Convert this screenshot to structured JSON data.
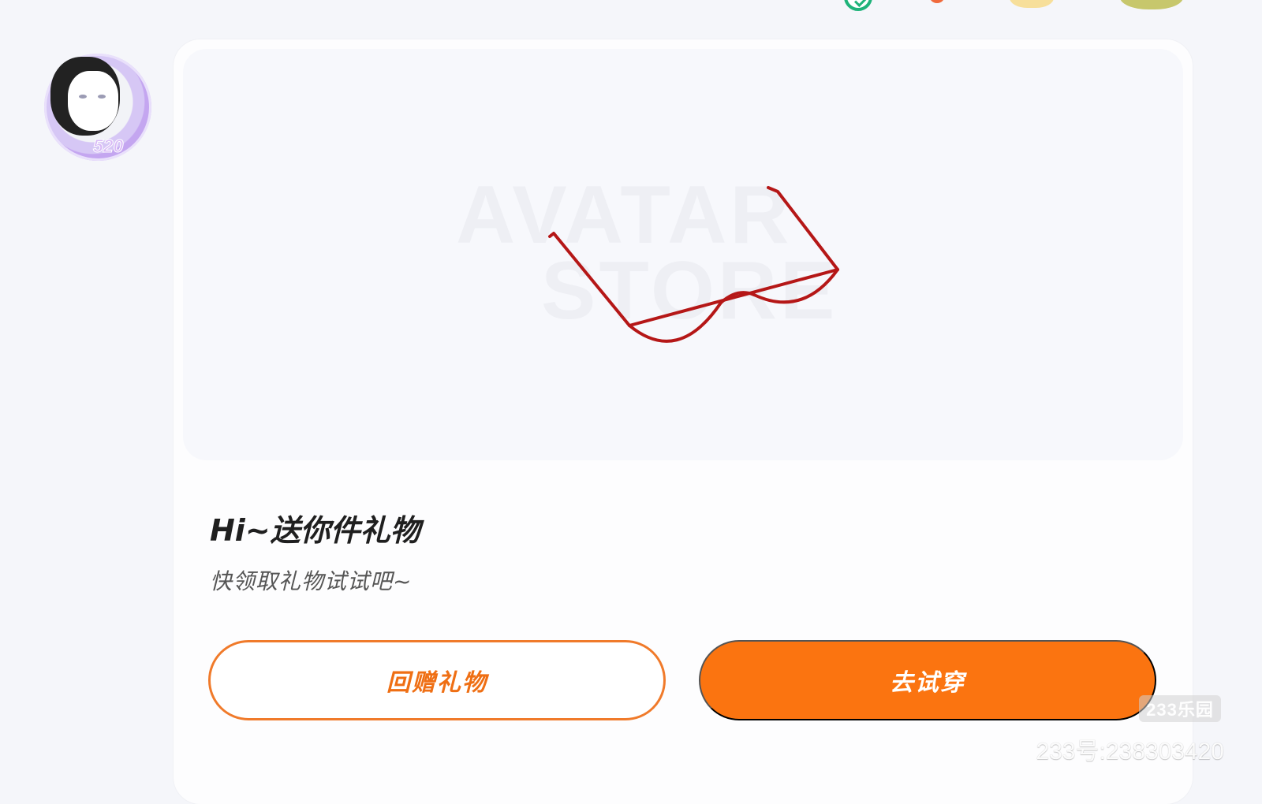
{
  "preview": {
    "watermark_line_1": "AVATAR",
    "watermark_line_2": "STORE"
  },
  "gift": {
    "title": "Hi~送你件礼物",
    "subtitle": "快领取礼物试试吧~",
    "return_gift_label": "回赠礼物",
    "try_on_label": "去试穿"
  },
  "avatar": {
    "badge_text": "520"
  },
  "watermark": {
    "brand": "233乐园",
    "account": "233号:238303420"
  },
  "colors": {
    "accent": "#fb7410",
    "accent_outline": "#f07a2a",
    "background": "#f5f6fa",
    "card": "#fdfdfe"
  },
  "icons": {
    "top": [
      "check-icon",
      "status-dot-icon",
      "gold-decoration-icon",
      "gold-decoration-icon"
    ],
    "item": "glasses-icon"
  }
}
